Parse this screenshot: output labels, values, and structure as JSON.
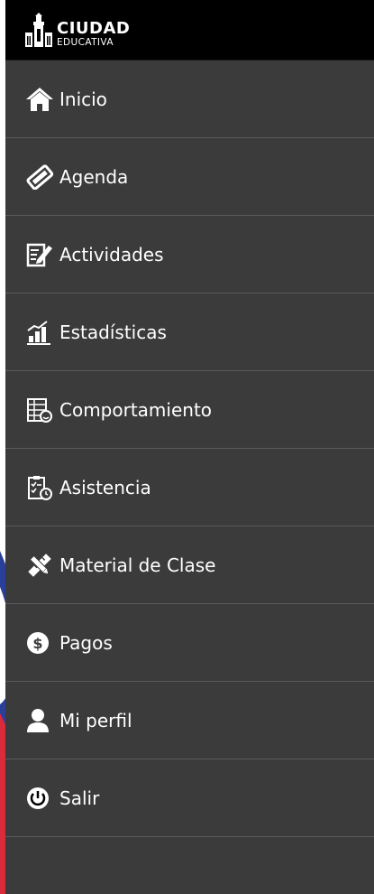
{
  "brand": {
    "title": "CIUDAD",
    "subtitle": "EDUCATIVA"
  },
  "colors": {
    "sidebar": "#3b3b3b",
    "header": "#000000",
    "divider": "#5a5a5a",
    "text": "#ffffff"
  },
  "menu": {
    "items": [
      {
        "label": "Inicio",
        "icon": "home-icon"
      },
      {
        "label": "Agenda",
        "icon": "agenda-icon"
      },
      {
        "label": "Actividades",
        "icon": "activities-icon"
      },
      {
        "label": "Estadísticas",
        "icon": "statistics-icon"
      },
      {
        "label": "Comportamiento",
        "icon": "behavior-icon"
      },
      {
        "label": "Asistencia",
        "icon": "attendance-icon"
      },
      {
        "label": "Material de Clase",
        "icon": "class-material-icon"
      },
      {
        "label": "Pagos",
        "icon": "payments-icon"
      },
      {
        "label": "Mi perfil",
        "icon": "profile-icon"
      },
      {
        "label": "Salir",
        "icon": "logout-icon"
      }
    ]
  }
}
